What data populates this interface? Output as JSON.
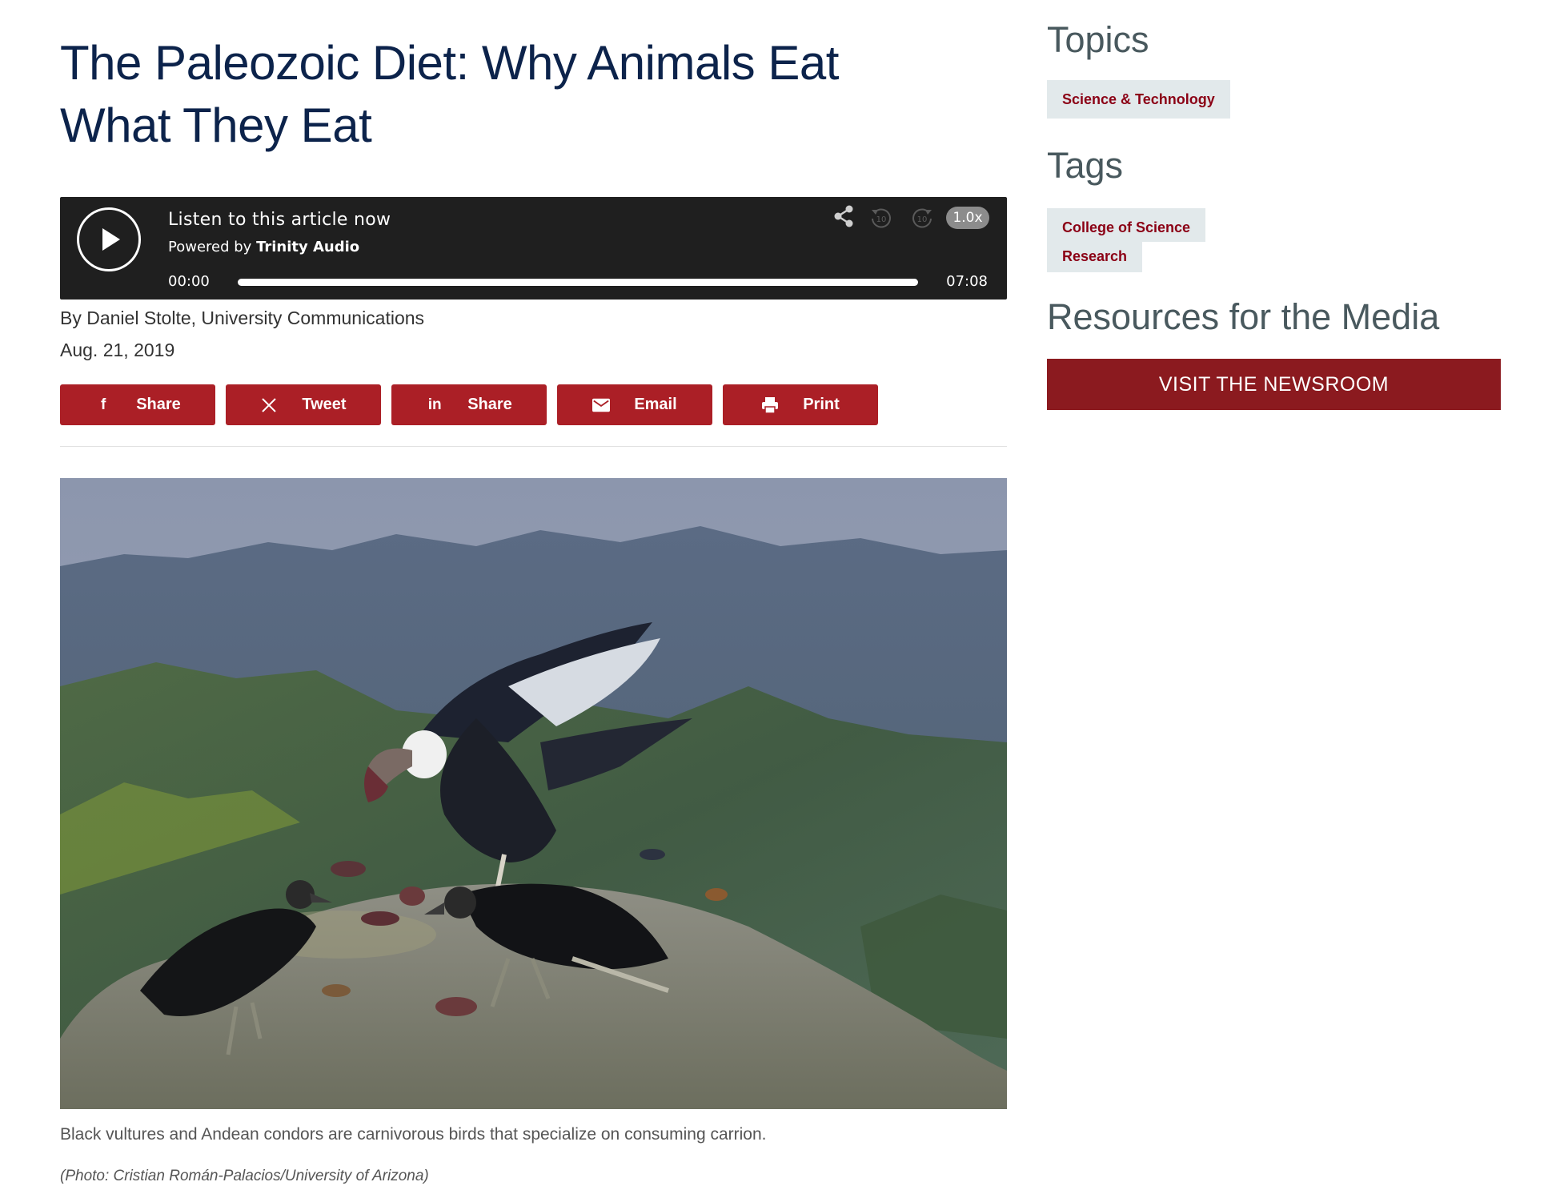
{
  "article": {
    "title": "The Paleozoic Diet: Why Animals Eat What They Eat",
    "byline": "By Daniel Stolte, University Communications",
    "date": "Aug. 21, 2019",
    "caption": "Black vultures and Andean condors are carnivorous birds that specialize on consuming carrion.",
    "credit": "(Photo: Cristian Román-Palacios/University of Arizona)"
  },
  "player": {
    "title": "Listen to this article now",
    "powered_prefix": "Powered by",
    "powered_brand": "Trinity Audio",
    "time_current": "00:00",
    "time_total": "07:08",
    "speed": "1.0x",
    "rewind_label": "10",
    "forward_label": "10",
    "progress_fraction": 0.0
  },
  "share": [
    {
      "icon": "facebook-icon",
      "glyph": "f",
      "label": "Share"
    },
    {
      "icon": "x-icon",
      "glyph": "𝕏",
      "label": "Tweet"
    },
    {
      "icon": "linkedin-icon",
      "glyph": "in",
      "label": "Share"
    },
    {
      "icon": "email-icon",
      "glyph": "",
      "label": "Email"
    },
    {
      "icon": "print-icon",
      "glyph": "",
      "label": "Print"
    }
  ],
  "sidebar": {
    "topics_heading": "Topics",
    "topics": [
      "Science & Technology"
    ],
    "tags_heading": "Tags",
    "tags": [
      "College of Science",
      "Research"
    ],
    "resources_heading": "Resources for the Media",
    "newsroom_button": "VISIT THE NEWSROOM"
  },
  "colors": {
    "title": "#0c234b",
    "button_red": "#ab1f26",
    "newsroom_red": "#8b1a1f",
    "chip_bg": "#e2e9eb",
    "chip_text": "#8b0015",
    "player_bg": "#1f1f1f"
  }
}
